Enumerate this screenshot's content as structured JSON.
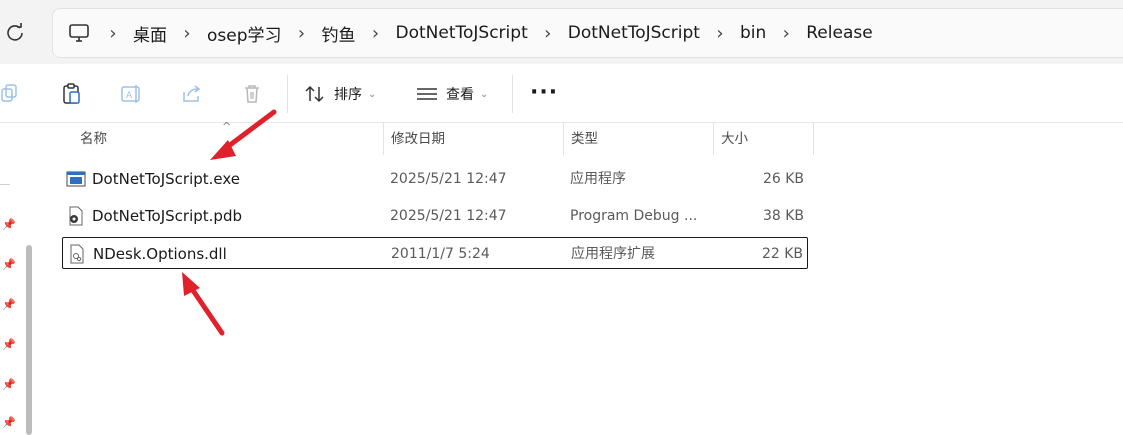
{
  "breadcrumb": [
    "桌面",
    "osep学习",
    "钓鱼",
    "DotNetToJScript",
    "DotNetToJScript",
    "bin",
    "Release"
  ],
  "toolbar": {
    "sort_label": "排序",
    "view_label": "查看",
    "more_label": "···"
  },
  "columns": {
    "name": "名称",
    "date": "修改日期",
    "type": "类型",
    "size": "大小"
  },
  "files": [
    {
      "name": "DotNetToJScript.exe",
      "date": "2025/5/21 12:47",
      "type": "应用程序",
      "size": "26 KB",
      "icon": "exe-file-icon"
    },
    {
      "name": "DotNetToJScript.pdb",
      "date": "2025/5/21 12:47",
      "type": "Program Debug ...",
      "size": "38 KB",
      "icon": "pdb-file-icon"
    },
    {
      "name": "NDesk.Options.dll",
      "date": "2011/1/7 5:24",
      "type": "应用程序扩展",
      "size": "22 KB",
      "icon": "dll-file-icon",
      "selected": true
    }
  ],
  "annotation_color": "#e0202a"
}
